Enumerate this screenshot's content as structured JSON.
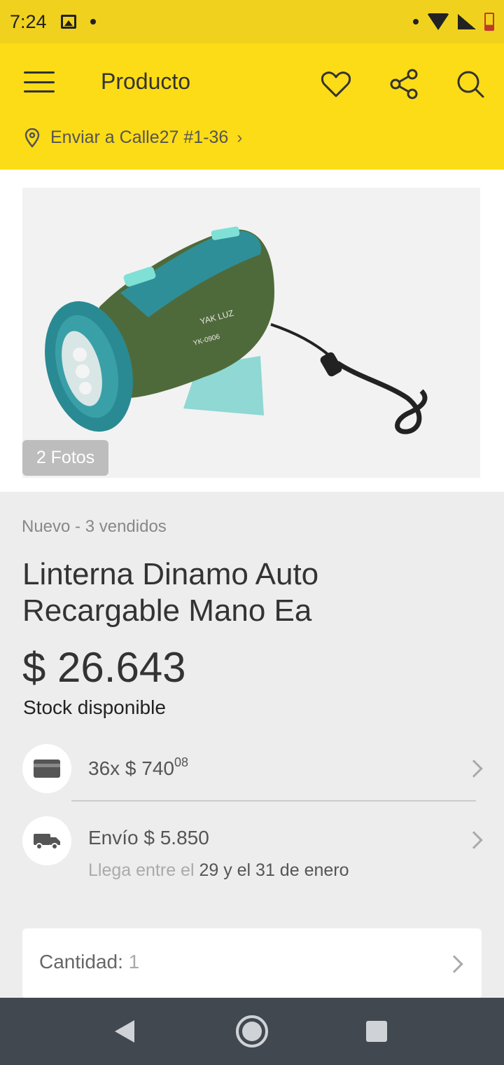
{
  "status_bar": {
    "time": "7:24"
  },
  "app_bar": {
    "title": "Producto",
    "location_label": "Enviar a Calle27 #1-36"
  },
  "gallery": {
    "photos_badge": "2 Fotos",
    "brand_print": "YAK LUZ",
    "model_print": "YK-0906"
  },
  "product": {
    "condition": "Nuevo - 3 vendidos",
    "title": "Linterna Dinamo Auto Recargable Mano  Ea",
    "price": "$ 26.643",
    "stock": "Stock disponible"
  },
  "installments": {
    "prefix": "36x $ 740",
    "cents": "08"
  },
  "shipping": {
    "label": "Envío $ 5.850",
    "eta_prefix": "Llega entre el ",
    "eta_dates": "29 y el 31 de enero"
  },
  "quantity": {
    "label": "Cantidad: ",
    "value": "1"
  }
}
